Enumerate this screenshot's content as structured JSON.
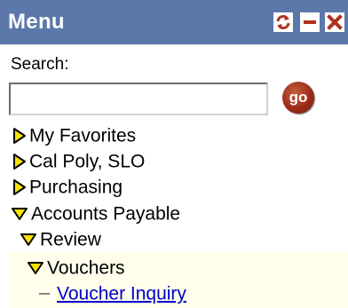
{
  "header": {
    "title": "Menu",
    "buttons": {
      "refresh": "refresh-icon",
      "minimize": "minimize-icon",
      "close": "close-icon"
    }
  },
  "search": {
    "label": "Search:",
    "value": "",
    "go_label": "go"
  },
  "tree": [
    {
      "label": "My Favorites",
      "state": "collapsed"
    },
    {
      "label": "Cal Poly, SLO",
      "state": "collapsed"
    },
    {
      "label": "Purchasing",
      "state": "collapsed"
    },
    {
      "label": "Accounts Payable",
      "state": "expanded"
    },
    {
      "label": "Review",
      "state": "expanded"
    },
    {
      "label": "Vouchers",
      "state": "expanded"
    },
    {
      "label": "Voucher Inquiry",
      "state": "leaf"
    }
  ],
  "colors": {
    "header_bg": "#5c78ab",
    "header_button_icon": "#b03020",
    "triangle_fill": "#f5e400",
    "highlight_bg": "#ffffeb",
    "link": "#0000cc"
  }
}
